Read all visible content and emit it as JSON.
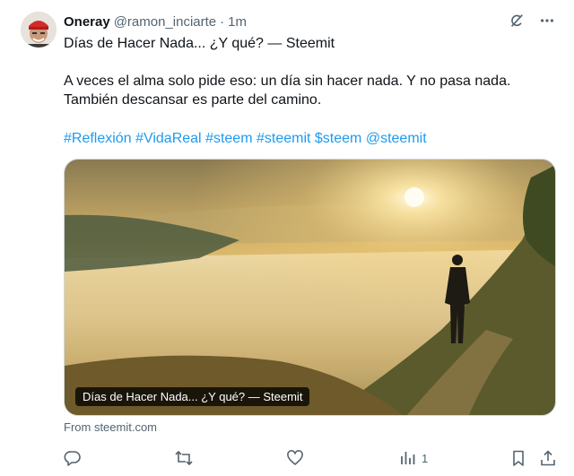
{
  "author": {
    "name": "Oneray",
    "handle": "@ramon_inciarte",
    "separator": "·",
    "time": "1m"
  },
  "post": {
    "title_line": "Días de Hacer Nada... ¿Y qué? — Steemit",
    "body_line1": "A veces el alma solo pide eso: un día sin hacer nada. Y no pasa nada.",
    "body_line2": "También descansar es parte del camino.",
    "hashtags": [
      "#Reflexión",
      "#VidaReal",
      "#steem",
      "#steemit",
      "$steem",
      "@steemit"
    ]
  },
  "link_card": {
    "title": "Días de Hacer Nada... ¿Y qué? — Steemit",
    "source": "From steemit.com"
  },
  "actions": {
    "views_count": "1"
  },
  "colors": {
    "link": "#1d9bf0",
    "secondary_text": "#536471",
    "primary_text": "#0f1419"
  },
  "icons": [
    "grok-icon",
    "more-icon",
    "reply-icon",
    "retweet-icon",
    "like-icon",
    "views-icon",
    "bookmark-icon",
    "share-icon"
  ]
}
